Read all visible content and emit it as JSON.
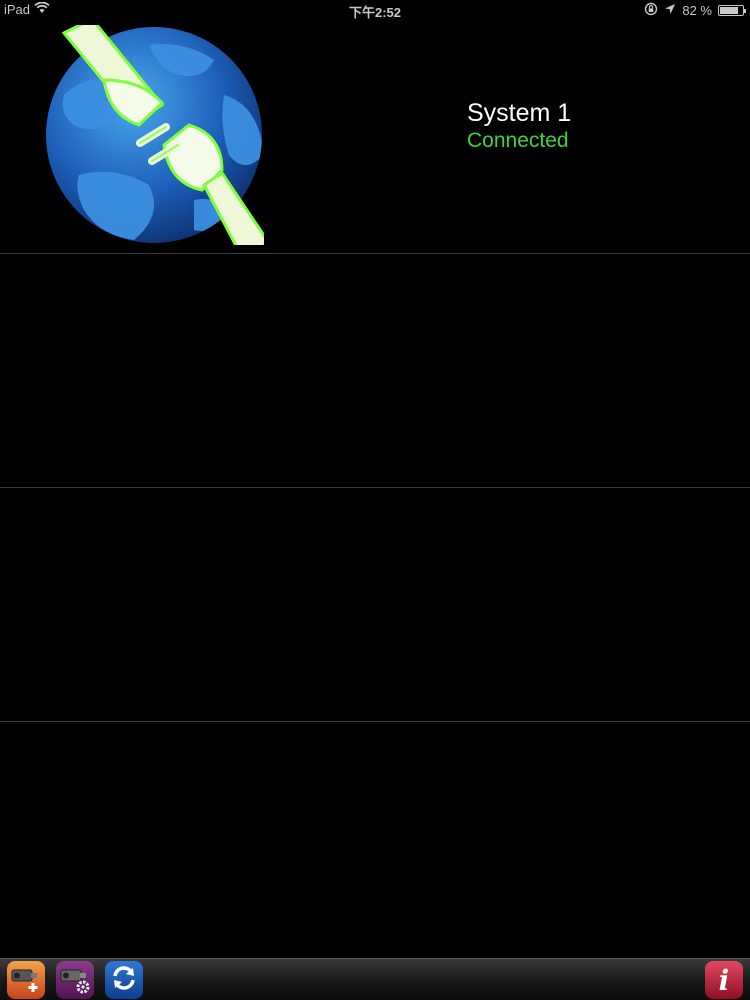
{
  "status_bar": {
    "device": "iPad",
    "time": "下午2:52",
    "battery": "82 %",
    "battery_level": 0.82,
    "icons": [
      "wifi-icon",
      "rotation-lock-icon",
      "location-arrow-icon",
      "battery-icon"
    ]
  },
  "systems": [
    {
      "name": "System 1",
      "status": "Connected",
      "status_color": "#3fd43a",
      "icon": "globe-plug-icon"
    }
  ],
  "toolbar": {
    "buttons": [
      {
        "icon": "camera-add-icon"
      },
      {
        "icon": "camera-settings-icon"
      },
      {
        "icon": "refresh-icon"
      },
      {
        "icon": "info-icon",
        "glyph": "i"
      }
    ]
  },
  "colors": {
    "background": "#000000",
    "status_connected": "#3fd43a",
    "divider": "#3a3a3a"
  }
}
